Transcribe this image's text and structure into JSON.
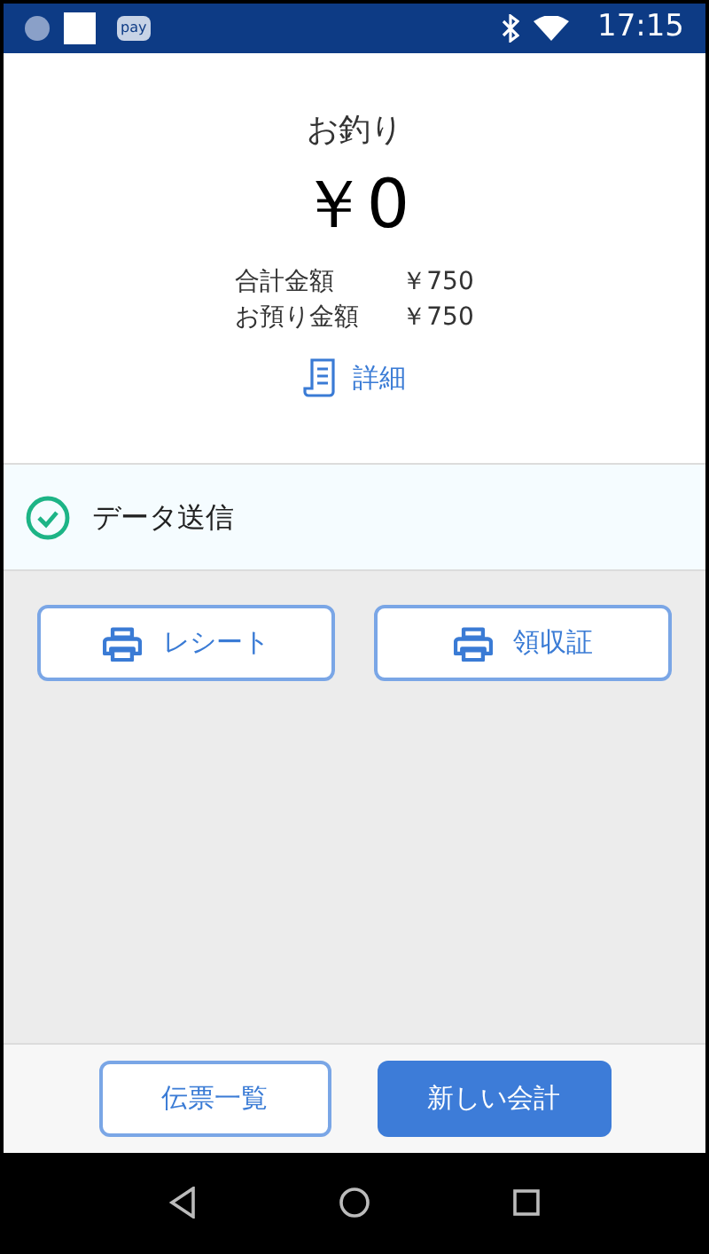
{
  "status_bar": {
    "badge": "pay",
    "time": "17:15"
  },
  "change": {
    "label": "お釣り",
    "amount": "￥0"
  },
  "summary": [
    {
      "label": "合計金額",
      "value": "￥750"
    },
    {
      "label": "お預り金額",
      "value": "￥750"
    }
  ],
  "details_link": "詳細",
  "transmission": {
    "label": "データ送信",
    "kind": "success"
  },
  "print_buttons": [
    "レシート",
    "領収証"
  ],
  "footer_buttons": [
    {
      "label": "伝票一覧",
      "kind": "outline"
    },
    {
      "label": "新しい会計",
      "kind": "primary"
    }
  ]
}
